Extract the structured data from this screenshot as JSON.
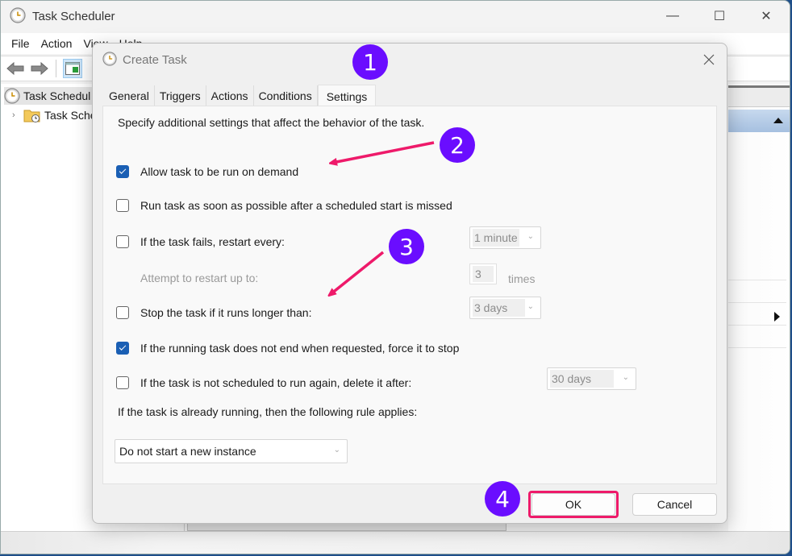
{
  "main_window": {
    "title": "Task Scheduler",
    "controls": {
      "minimize": "—",
      "maximize": "☐",
      "close": "✕"
    },
    "menu": [
      "File",
      "Action",
      "View",
      "Help"
    ],
    "tree": {
      "root_label": "Task Scheduler (Local)",
      "root_visible": "Task Schedul",
      "child_label": "Task Scheduler Library",
      "child_visible": "Task Sche"
    }
  },
  "dialog": {
    "title": "Create Task",
    "close_glyph": "✕",
    "tabs": [
      {
        "label": "General",
        "selected": false
      },
      {
        "label": "Triggers",
        "selected": false
      },
      {
        "label": "Actions",
        "selected": false
      },
      {
        "label": "Conditions",
        "selected": false
      },
      {
        "label": "Settings",
        "selected": true
      }
    ],
    "settings": {
      "intro": "Specify additional settings that affect the behavior of the task.",
      "options": [
        {
          "label": "Allow task to be run on demand",
          "checked": true
        },
        {
          "label": "Run task as soon as possible after a scheduled start is missed",
          "checked": false
        },
        {
          "label": "If the task fails, restart every:",
          "checked": false
        },
        {
          "label": "Stop the task if it runs longer than:",
          "checked": false
        },
        {
          "label": "If the running task does not end when requested, force it to stop",
          "checked": true
        },
        {
          "label": "If the task is not scheduled to run again, delete it after:",
          "checked": false
        }
      ],
      "restart_interval": "1 minute",
      "restart_attempts_label": "Attempt to restart up to:",
      "restart_attempts": "3",
      "restart_attempts_unit": "times",
      "stop_after": "3 days",
      "delete_after": "30 days",
      "running_rule_label": "If the task is already running, then the following rule applies:",
      "running_rule": "Do not start a new instance"
    },
    "buttons": {
      "ok": "OK",
      "cancel": "Cancel"
    }
  },
  "annotations": {
    "badges": [
      "1",
      "2",
      "3",
      "4"
    ],
    "colors": {
      "badge": "#6a0dff",
      "arrow": "#ee1a6a",
      "highlight": "#ee1a6a",
      "checkbox": "#1a5fb4"
    }
  }
}
